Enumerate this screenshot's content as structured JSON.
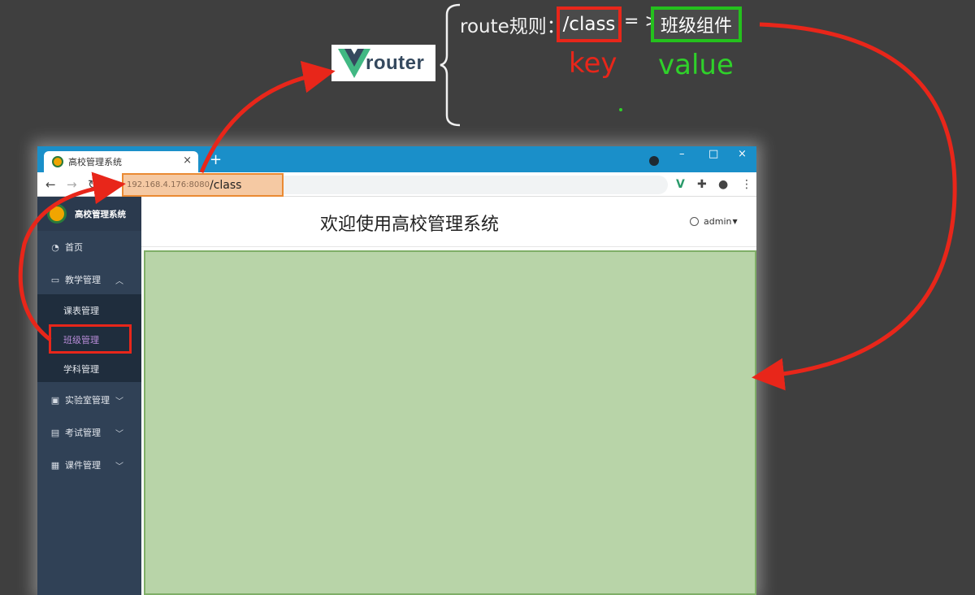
{
  "diagram": {
    "logo_text": "router",
    "rule_label": "route规则：",
    "key": "/class",
    "arrow": "= >",
    "value": "班级组件",
    "key_label": "key",
    "value_label": "value"
  },
  "browser": {
    "tab_title": "高校管理系统",
    "tab_close": "×",
    "new_tab": "+",
    "url_host": "192.168.4.176:8080",
    "url_path": "/class",
    "win_controls": [
      "–",
      "□",
      "×"
    ]
  },
  "sidebar": {
    "brand": "高校管理系统",
    "items": [
      {
        "label": "首页",
        "icon": "dashboard-icon"
      },
      {
        "label": "教学管理",
        "icon": "monitor-icon"
      },
      {
        "label": "实验室管理",
        "icon": "lab-icon"
      },
      {
        "label": "考试管理",
        "icon": "exam-icon"
      },
      {
        "label": "课件管理",
        "icon": "courseware-icon"
      }
    ],
    "sub_items": [
      "课表管理",
      "班级管理",
      "学科管理"
    ]
  },
  "header": {
    "title": "欢迎使用高校管理系统",
    "user": "admin"
  },
  "colors": {
    "key_red": "#e8261a",
    "value_green": "#24c11d",
    "sidebar_bg": "#304156",
    "content_green": "#b8d4a8"
  }
}
